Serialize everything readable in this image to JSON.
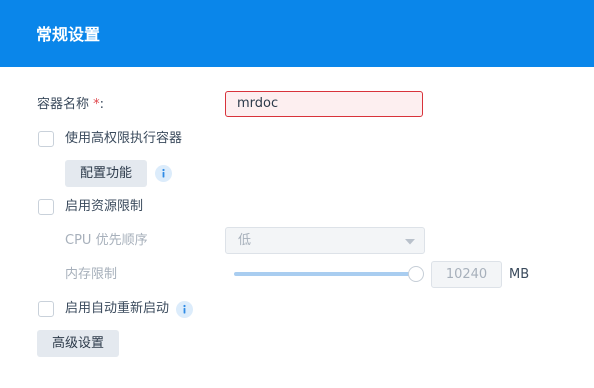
{
  "header": {
    "title": "常规设置"
  },
  "container_name": {
    "label": "容器名称",
    "required_mark": "*",
    "colon": ":",
    "value": "mrdoc"
  },
  "high_privilege": {
    "label": "使用高权限执行容器",
    "checked": false
  },
  "configure_button": {
    "label": "配置功能"
  },
  "resource_limit": {
    "label": "启用资源限制",
    "checked": false
  },
  "cpu_priority": {
    "label": "CPU 优先顺序",
    "value": "低"
  },
  "memory_limit": {
    "label": "内存限制",
    "value": "10240",
    "unit": "MB",
    "slider_fraction": 1.0
  },
  "auto_restart": {
    "label": "启用自动重新启动",
    "checked": false
  },
  "advanced_button": {
    "label": "高级设置"
  },
  "icons": {
    "info": "info-icon",
    "dropdown": "chevron-down-icon"
  },
  "colors": {
    "header": "#0a86ea",
    "error_border": "#d8333b",
    "slider": "#a9cdf0"
  }
}
